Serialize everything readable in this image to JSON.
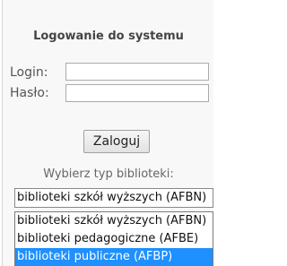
{
  "login_panel": {
    "title": "Logowanie do systemu",
    "login_label": "Login:",
    "login_value": "",
    "password_label": "Hasło:",
    "password_value": "",
    "submit_label": "Zaloguj"
  },
  "library_type": {
    "label": "Wybierz typ biblioteki:",
    "selected_value": "biblioteki szkół wyższych (AFBN)",
    "options": [
      "biblioteki szkół wyższych (AFBN)",
      "biblioteki pedagogiczne (AFBE)",
      "biblioteki publiczne (AFBP)"
    ],
    "highlighted_option": "biblioteki publiczne (AFBP)",
    "highlight_color": "#1e90ff"
  }
}
